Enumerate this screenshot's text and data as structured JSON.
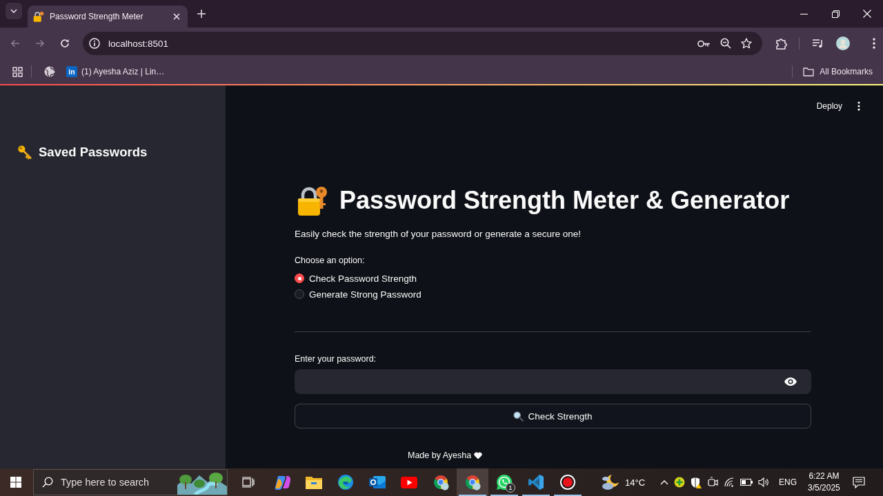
{
  "browser": {
    "tabs": [
      {
        "title": "Password Strength Meter",
        "selected": true
      }
    ],
    "back": {
      "disabled": true
    },
    "forward": {
      "disabled": true
    },
    "address": "localhost:8501",
    "bookmarks": [
      {
        "favicon": "in",
        "label": "(1) Ayesha Aziz | Lin…"
      }
    ],
    "all_bookmarks": "All Bookmarks"
  },
  "app_header": {
    "deploy": "Deploy"
  },
  "sidebar": {
    "title": "Saved Passwords"
  },
  "main": {
    "title": "Password Strength Meter & Generator",
    "subtitle": "Easily check the strength of your password or generate a secure one!",
    "option_label": "Choose an option:",
    "options": [
      {
        "label": "Check Password Strength",
        "selected": true
      },
      {
        "label": "Generate Strong Password",
        "selected": false
      }
    ],
    "password_label": "Enter your password:",
    "check_button": "Check Strength",
    "footer": "Made by Ayesha"
  },
  "taskbar": {
    "search": {
      "placeholder": "Type here to search"
    },
    "apps": [
      {
        "kind": "swirl",
        "running": false,
        "selected": false
      },
      {
        "kind": "folder",
        "running": false,
        "selected": false
      },
      {
        "kind": "wave",
        "running": false,
        "selected": false
      },
      {
        "kind": "mail",
        "running": false,
        "selected": false
      },
      {
        "kind": "play",
        "running": false,
        "selected": false
      },
      {
        "kind": "pinwheel-profile",
        "running": false,
        "selected": false
      },
      {
        "kind": "pinwheel-profile",
        "running": true,
        "selected": true
      },
      {
        "kind": "chat",
        "running": true,
        "selected": false,
        "badge": "1"
      },
      {
        "kind": "ribbon",
        "running": true,
        "selected": false
      },
      {
        "kind": "record",
        "running": true,
        "selected": false
      }
    ],
    "weather": "14°C",
    "language": "ENG",
    "time": "6:22 AM",
    "date": "3/5/2025"
  }
}
